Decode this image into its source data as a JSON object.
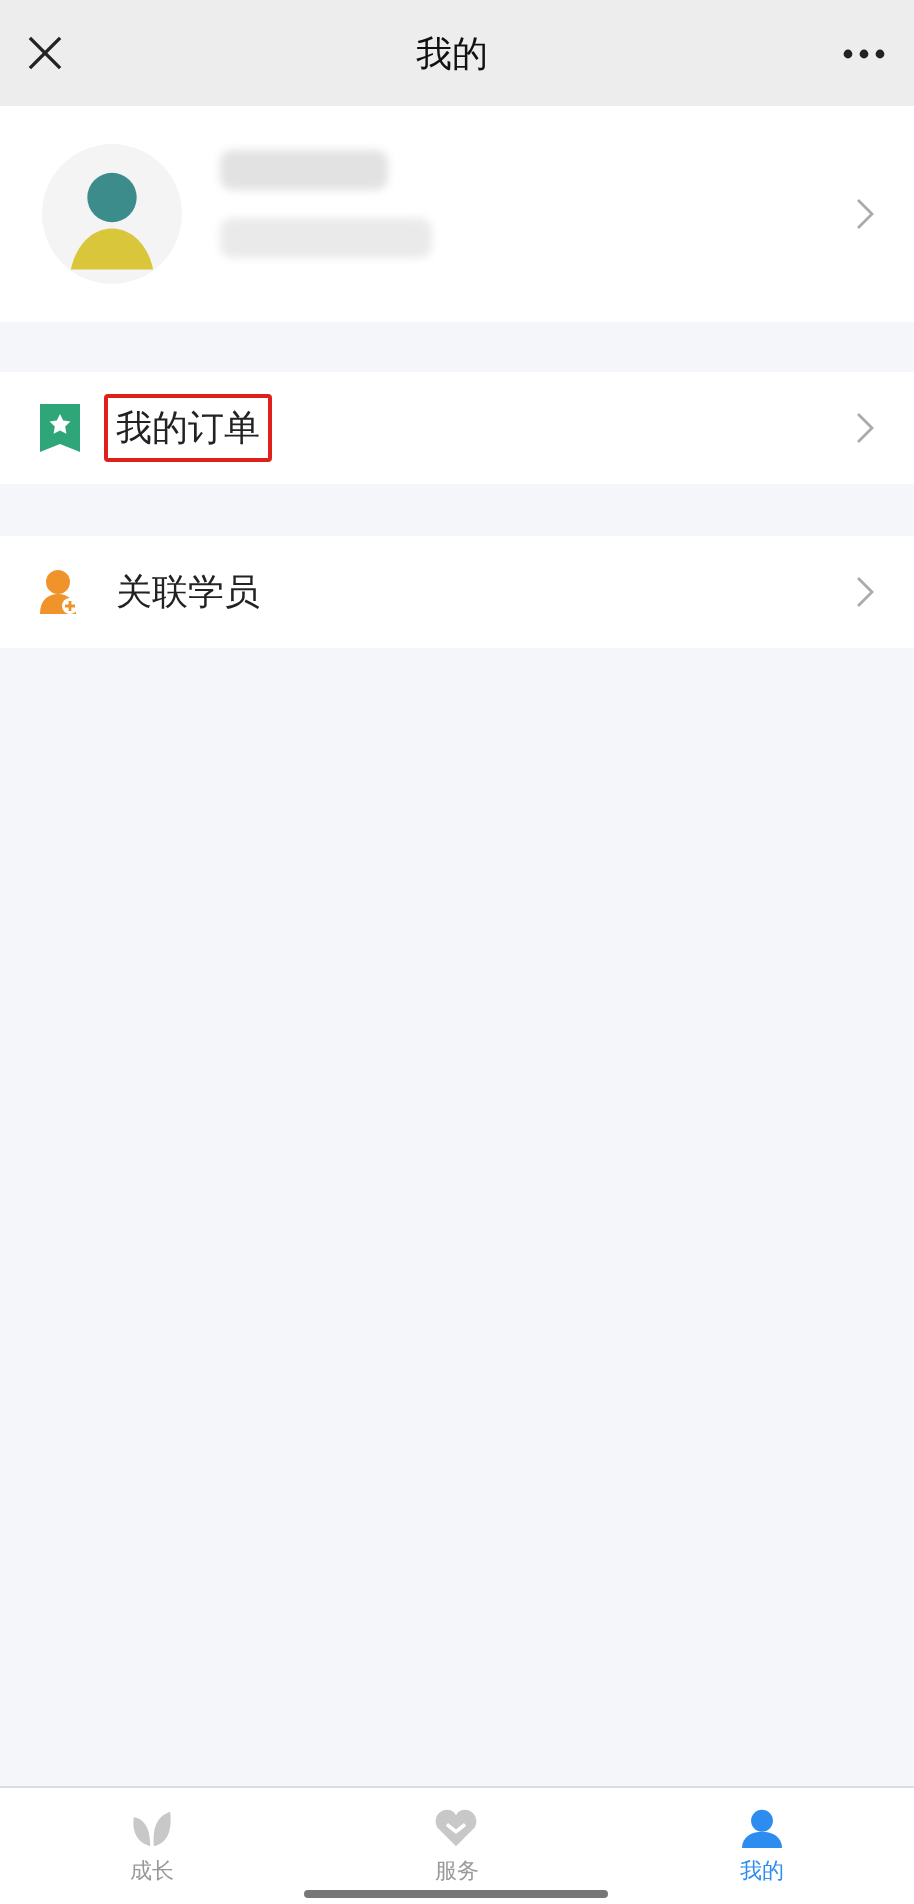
{
  "nav": {
    "title": "我的"
  },
  "menu": [
    {
      "label": "我的订单",
      "kind": "orders",
      "highlighted": true
    },
    {
      "label": "关联学员",
      "kind": "students",
      "highlighted": false
    }
  ],
  "tabs": [
    {
      "label": "成长",
      "kind": "leaf",
      "selected": false
    },
    {
      "label": "服务",
      "kind": "heart",
      "selected": false
    },
    {
      "label": "我的",
      "kind": "person",
      "selected": true
    }
  ]
}
